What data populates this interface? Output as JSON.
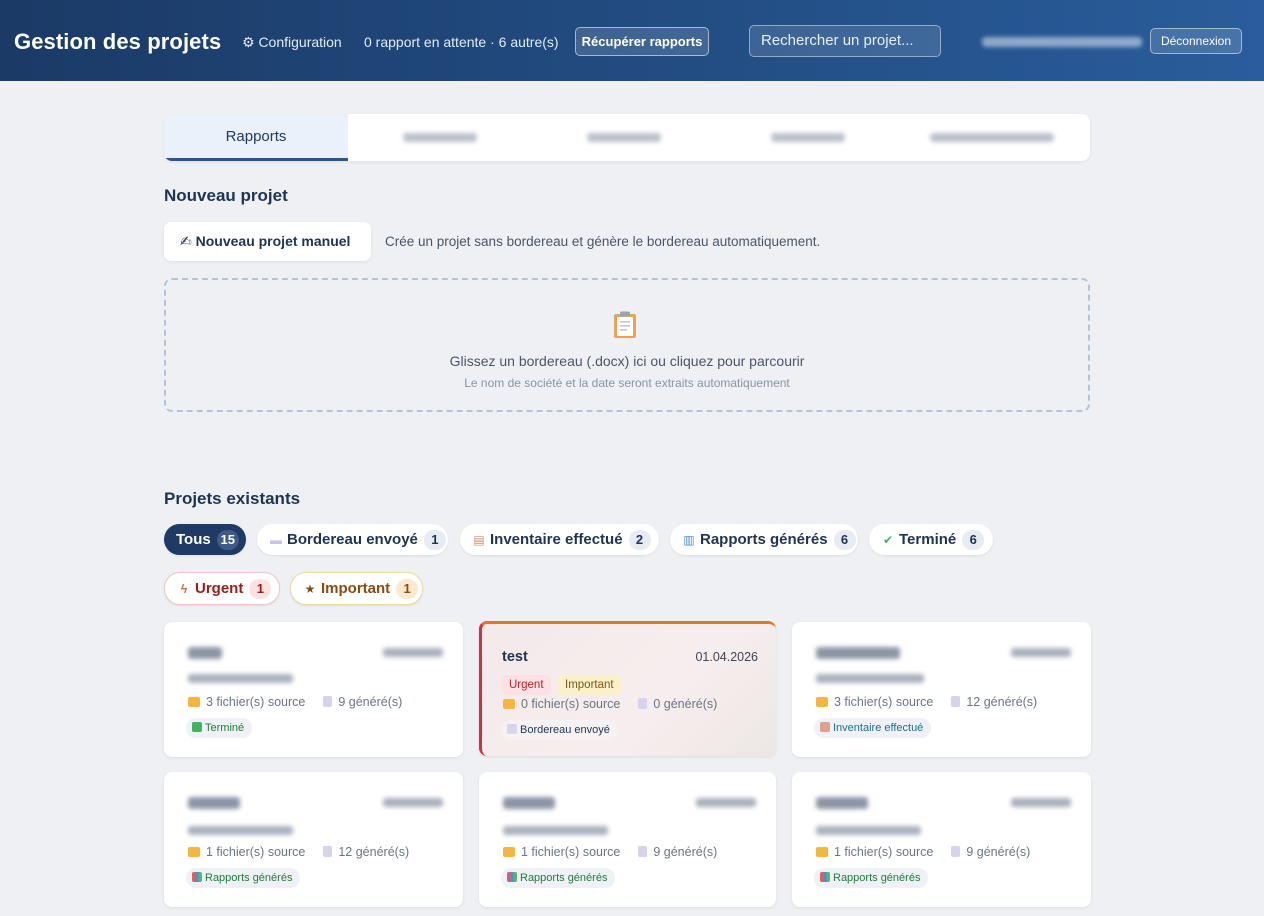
{
  "header": {
    "app_title": "Gestion des projets",
    "config_label": "⚙ Configuration",
    "pending_text": "0 rapport en attente · 6 autre(s)",
    "fetch_button": "Récupérer rapports",
    "search_placeholder": "Rechercher un projet...",
    "logout_button": "Déconnexion"
  },
  "tabs": [
    {
      "label": "Rapports",
      "active": true
    }
  ],
  "new_project": {
    "section_title": "Nouveau projet",
    "manual_button": "✍ Nouveau projet manuel",
    "manual_description": "Crée un projet sans bordereau et génère le bordereau automatiquement.",
    "dropzone_title": "Glissez un bordereau (.docx) ici ou cliquez pour parcourir",
    "dropzone_subtitle": "Le nom de société et la date seront extraits automatiquement"
  },
  "existing_projects": {
    "section_title": "Projets existants",
    "filters": [
      {
        "label": "Tous",
        "count": "15"
      },
      {
        "label": "Bordereau envoyé",
        "count": "1"
      },
      {
        "label": "Inventaire effectué",
        "count": "2"
      },
      {
        "label": "Rapports générés",
        "count": "6"
      },
      {
        "label": "Terminé",
        "count": "6"
      },
      {
        "label": "Urgent",
        "count": "1"
      },
      {
        "label": "Important",
        "count": "1"
      }
    ],
    "cards": [
      {
        "sources": "3 fichier(s) source",
        "generated": "9 généré(s)",
        "status": "Terminé"
      },
      {
        "title": "test",
        "date": "01.04.2026",
        "tag_urgent": "Urgent",
        "tag_important": "Important",
        "sources": "0 fichier(s) source",
        "generated": "0 généré(s)",
        "status": "Bordereau envoyé"
      },
      {
        "sources": "3 fichier(s) source",
        "generated": "12 généré(s)",
        "status": "Inventaire effectué"
      },
      {
        "sources": "1 fichier(s) source",
        "generated": "12 généré(s)",
        "status": "Rapports générés"
      },
      {
        "sources": "1 fichier(s) source",
        "generated": "9 généré(s)",
        "status": "Rapports générés"
      },
      {
        "sources": "1 fichier(s) source",
        "generated": "9 généré(s)",
        "status": "Rapports générés"
      }
    ]
  },
  "colors": {
    "header_start": "#1b3a66",
    "header_end": "#2a5d9c",
    "accent_urgent": "#d52f3c",
    "accent_important": "#e07a1a"
  }
}
